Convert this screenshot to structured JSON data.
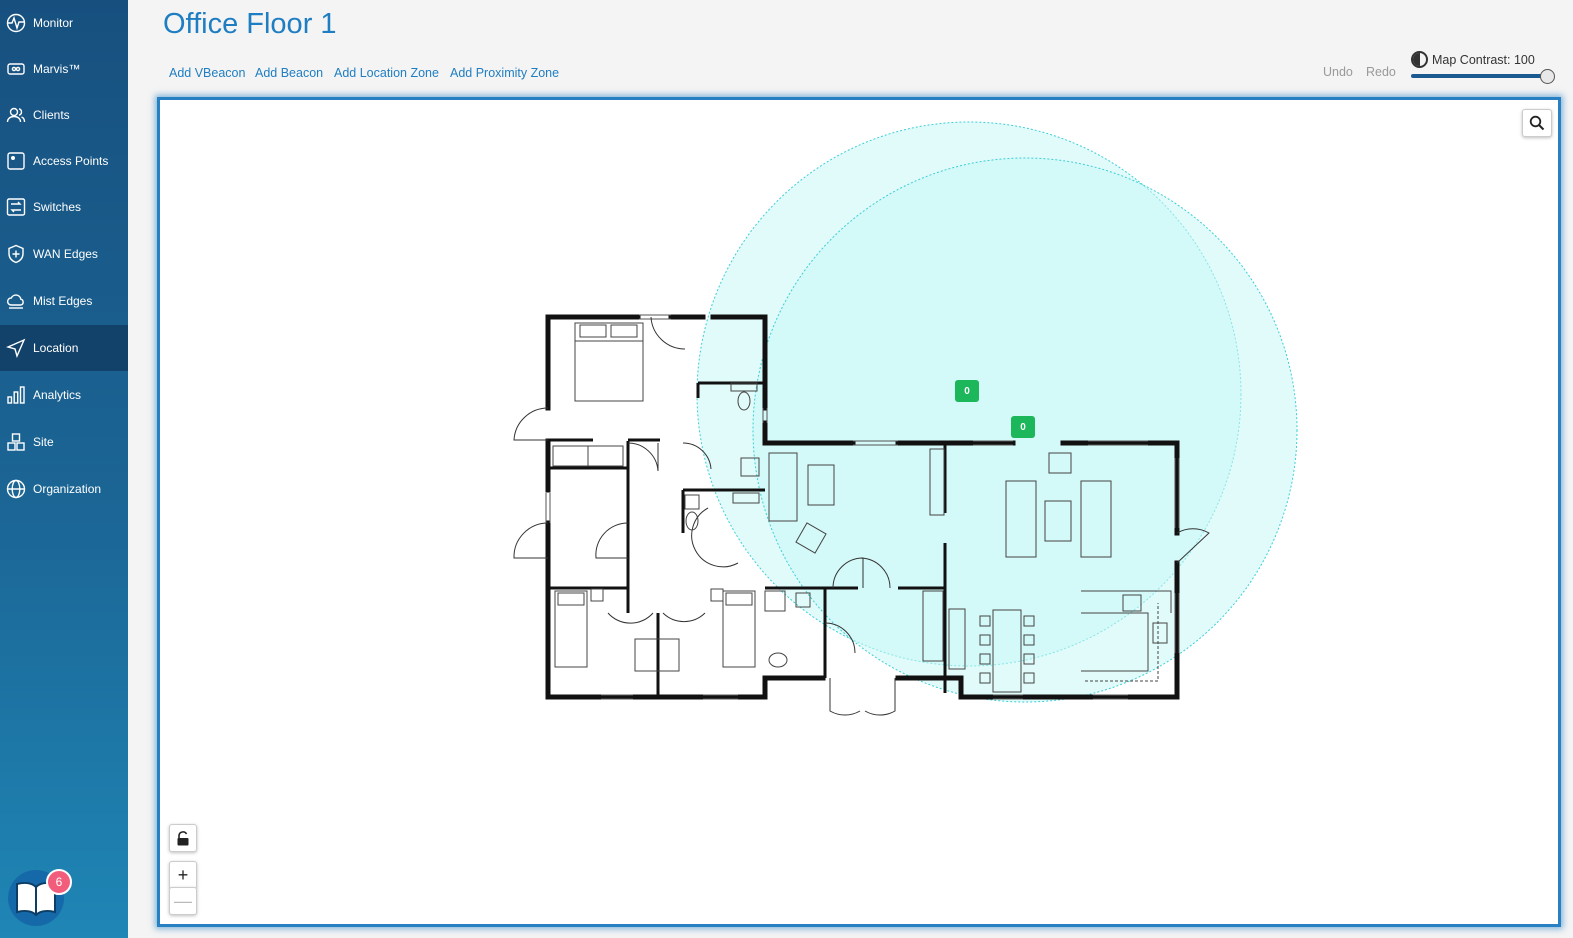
{
  "sidebar": {
    "items": [
      {
        "label": "Monitor",
        "icon": "pulse-icon"
      },
      {
        "label": "Marvis™",
        "icon": "marvis-icon"
      },
      {
        "label": "Clients",
        "icon": "users-icon"
      },
      {
        "label": "Access Points",
        "icon": "access-point-icon"
      },
      {
        "label": "Switches",
        "icon": "switch-icon"
      },
      {
        "label": "WAN Edges",
        "icon": "shield-plus-icon"
      },
      {
        "label": "Mist Edges",
        "icon": "cloud-icon"
      },
      {
        "label": "Location",
        "icon": "location-arrow-icon"
      },
      {
        "label": "Analytics",
        "icon": "bar-chart-icon"
      },
      {
        "label": "Site",
        "icon": "site-icon"
      },
      {
        "label": "Organization",
        "icon": "globe-icon"
      }
    ],
    "active": "Location",
    "help_badge_count": "6"
  },
  "header": {
    "title": "Office Floor 1"
  },
  "toolbar": {
    "add_vbeacon": "Add VBeacon",
    "add_beacon": "Add Beacon",
    "add_location_zone": "Add Location Zone",
    "add_proximity_zone": "Add Proximity Zone",
    "undo": "Undo",
    "redo": "Redo",
    "map_contrast_label": "Map Contrast: 100",
    "map_contrast_value": 100
  },
  "map": {
    "beacons": [
      {
        "label": "0"
      },
      {
        "label": "0"
      }
    ],
    "zoom_in": "+",
    "zoom_out": "—",
    "colors": {
      "accent": "#1f7ec2",
      "beacon": "#1bb75a",
      "coverage": "#c8f7f5",
      "coverage_border": "#3ccfd6"
    }
  }
}
